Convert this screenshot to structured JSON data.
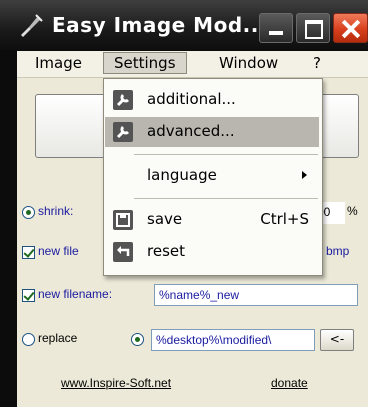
{
  "window": {
    "title": "Easy Image Mod..."
  },
  "menubar": {
    "items": [
      "Image",
      "Settings",
      "Window",
      "?"
    ]
  },
  "settings_menu": {
    "items": [
      {
        "label": "additional...",
        "icon": "wrench-icon"
      },
      {
        "label": "advanced...",
        "icon": "wrench-icon"
      },
      {
        "label": "language",
        "submenu": true
      },
      {
        "label": "save",
        "shortcut": "Ctrl+S",
        "icon": "save-icon"
      },
      {
        "label": "reset",
        "icon": "reset-icon"
      }
    ]
  },
  "form": {
    "shrink_label": "shrink:",
    "shrink_value_suffix": "00",
    "percent_sign": "%",
    "new_file_label": "new file",
    "format_suffix": "bmp",
    "new_filename_label": "new filename:",
    "new_filename_value": "%name%_new",
    "replace_label": "replace",
    "output_path_value": "%desktop%\\modified\\",
    "browse_label": "<-"
  },
  "footer": {
    "website_link": "www.Inspire-Soft.net",
    "donate_link": "donate"
  },
  "colors": {
    "menu_highlight": "#b8b6ae",
    "close_button": "#d8401c",
    "client_background": "#ece9d8"
  }
}
